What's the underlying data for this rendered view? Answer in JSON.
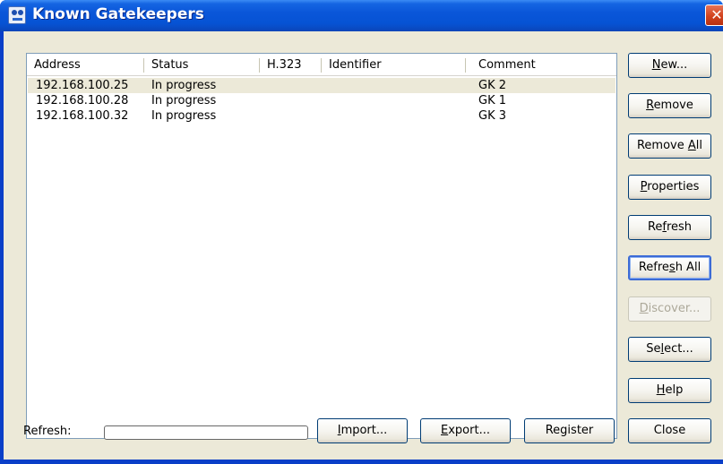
{
  "window": {
    "title": "Known Gatekeepers",
    "close_glyph": "✕"
  },
  "list": {
    "columns": [
      "Address",
      "Status",
      "H.323",
      "Identifier",
      "Comment"
    ],
    "rows": [
      {
        "address": "192.168.100.25",
        "status": "In progress",
        "h323": "",
        "identifier": "",
        "comment": "GK 2",
        "selected": true
      },
      {
        "address": "192.168.100.28",
        "status": "In progress",
        "h323": "",
        "identifier": "",
        "comment": "GK 1",
        "selected": false
      },
      {
        "address": "192.168.100.32",
        "status": "In progress",
        "h323": "",
        "identifier": "",
        "comment": "GK 3",
        "selected": false
      }
    ]
  },
  "buttons": {
    "new": {
      "label": "New...",
      "mnemonic": "N"
    },
    "remove": {
      "label": "Remove",
      "mnemonic": "R"
    },
    "remove_all": {
      "label": "Remove All",
      "mnemonic": "A"
    },
    "properties": {
      "label": "Properties",
      "mnemonic": "P"
    },
    "refresh": {
      "label": "Refresh",
      "mnemonic": "f"
    },
    "refresh_all": {
      "label": "Refresh All",
      "mnemonic": "s"
    },
    "discover": {
      "label": "Discover...",
      "mnemonic": "D",
      "disabled": true
    },
    "select": {
      "label": "Select...",
      "mnemonic": "l"
    },
    "help": {
      "label": "Help",
      "mnemonic": "H"
    },
    "import": {
      "label": "Import...",
      "mnemonic": "I"
    },
    "export": {
      "label": "Export...",
      "mnemonic": "E"
    },
    "register": {
      "label": "Register"
    },
    "close": {
      "label": "Close"
    }
  },
  "footer": {
    "refresh_label": "Refresh:",
    "progress_value": 0
  },
  "colors": {
    "titlebar": "#0a56d9",
    "dialog_face": "#ece9d8",
    "list_border": "#7f9db9",
    "progress_fill": "#2ba32b"
  },
  "icons": {
    "app": "gatekeeper-app-icon",
    "close": "close-icon"
  }
}
